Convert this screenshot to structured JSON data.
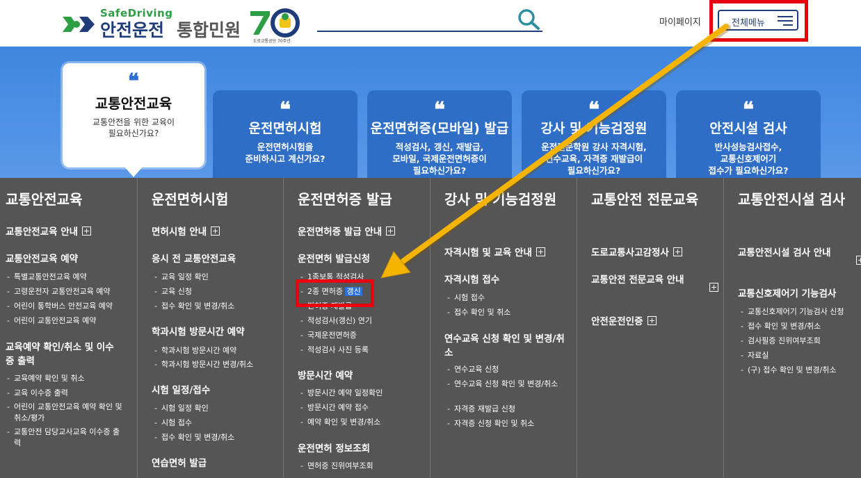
{
  "header": {
    "logo_sub": "SafeDriving",
    "logo_brand": "안전운전",
    "logo_title": "통합민원",
    "logo_badge": "도로교통공단 70주년",
    "mypage": "마이페이지",
    "menu_label": "전체메뉴"
  },
  "banner": {
    "bubble": {
      "quote": "❝",
      "title": "교통안전교육",
      "sub": "교통안전을 위한 교육이\n필요하신가요?"
    },
    "cards": [
      {
        "quote": "❝",
        "title": "운전면허시험",
        "sub": "운전면허시험을\n준비하시고 계신가요?"
      },
      {
        "quote": "❝",
        "title": "운전면허증(모바일) 발급",
        "sub": "적성검사, 갱신, 재발급,\n모바일, 국제운전면허증이\n필요하신가요?"
      },
      {
        "quote": "❝",
        "title": "강사 및 기능검정원",
        "sub": "운전전문학원 강사 자격시험,\n연수교육, 자격증 재발급이\n필요하신가요?"
      },
      {
        "quote": "❝",
        "title": "안전시설 검사",
        "sub": "반사성능검사접수,\n교통신호제어기\n접수가 필요하신가요?"
      }
    ]
  },
  "menu": {
    "col1": {
      "head": "교통안전교육",
      "s1": "교통안전교육 안내",
      "s2": "교통안전교육 예약",
      "s2_items": [
        "특별교통안전교육 예약",
        "고령운전자 교통안전교육 예약",
        "어린이 통학버스 안전교육 예약",
        "어린이 교통안전교육 예약"
      ],
      "s3": "교육예약 확인/취소 및 이수증 출력",
      "s3_items": [
        "교육예약 확인 및 취소",
        "교육 이수증 출력",
        "어린이 교통안전교육 예약 확인 및 취소/평가",
        "교통안전 담당교사교육 이수증 출력"
      ]
    },
    "col2": {
      "head": "운전면허시험",
      "s1": "면허시험 안내",
      "s2": "응시 전 교통안전교육",
      "s2_items": [
        "교육 일정 확인",
        "교육 신청",
        "접수 확인 및 변경/취소"
      ],
      "s3": "학과시험 방문시간 예약",
      "s3_items": [
        "학과시험 방문시간 예약",
        "학과시험 방문시간 변경/취소"
      ],
      "s4": "시험 일정/접수",
      "s4_items": [
        "시험 일정 확인",
        "시험 접수",
        "접수 확인 및 변경/취소"
      ],
      "s5": "연습면허 발급"
    },
    "col3": {
      "head": "운전면허증 발급",
      "s1": "운전면허증 발급 안내",
      "s2": "운전면허 발급신청",
      "s2_items": [
        "1종보통 적성검사",
        "2종 면허증 ",
        "갱신",
        "면허증 재발급",
        "적성검사(갱신) 연기",
        "국제운전면허증",
        "적성검사 사진 등록"
      ],
      "s3": "방문시간 예약",
      "s3_items": [
        "방문시간 예약 일정확인",
        "방문시간 예약 접수",
        "예약 확인 및 변경/취소"
      ],
      "s4": "운전면허 정보조회",
      "s4_items": [
        "면허증 진위여부조회"
      ]
    },
    "col4": {
      "head": "강사 및 기능검정원",
      "s1": "자격시험 및 교육 안내",
      "s2": "자격시험 접수",
      "s2_items": [
        "시험 접수",
        "접수 확인 및 취소"
      ],
      "s3": "연수교육 신청 확인 및 변경/취소",
      "s3_items": [
        "연수교육 신청",
        "연수교육 신청 확인 및 변경/취소",
        "자격증 재발급 신청",
        "자격증 신청 확인 및 취소"
      ]
    },
    "col5": {
      "head": "교통안전 전문교육",
      "s1": "도로교통사고감정사",
      "s2": "교통안전 전문교육 안내",
      "s3": "안전운전인증"
    },
    "col6": {
      "head": "교통안전시설 검사",
      "s1": "교통안전시설 검사 안내",
      "s2": "교통신호제어기 기능검사",
      "s2_items": [
        "교통신호제어기 기능검사 신청",
        "접수 확인 및 변경/취소",
        "검사필증 진위여부조회",
        "자료실",
        "(구) 접수 확인 및 변경/취소"
      ]
    }
  },
  "colors": {
    "brand_navy": "#1f3c7a",
    "brand_green": "#2e9e45",
    "banner_blue": "#3f86e0",
    "card_blue": "#2f6ec7",
    "menu_bg": "#555556",
    "highlight_red": "#e8000f",
    "arrow_yellow": "#f5b400"
  }
}
